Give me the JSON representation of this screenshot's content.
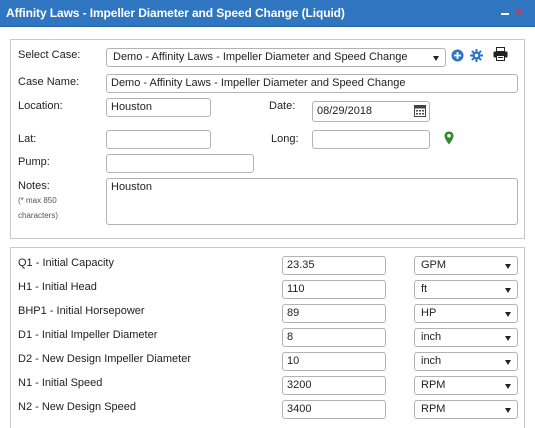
{
  "window": {
    "title": "Affinity Laws - Impeller Diameter and Speed Change (Liquid)",
    "minimize_icon": "minimize-icon",
    "close_icon": "close-icon",
    "close_glyph": "×",
    "accent_color": "#2f75c0"
  },
  "case_section": {
    "select_case": {
      "label": "Select Case:",
      "value": "Demo - Affinity Laws - Impeller Diameter and Speed Change"
    },
    "toolbar_icons": [
      "add-circle-icon",
      "gear-icon",
      "printer-icon"
    ],
    "case_name": {
      "label": "Case Name:",
      "value": "Demo - Affinity Laws - Impeller Diameter and Speed Change"
    },
    "location": {
      "label": "Location:",
      "value": "Houston"
    },
    "date": {
      "label": "Date:",
      "value": "08/29/2018",
      "icon": "calendar-icon"
    },
    "lat": {
      "label": "Lat:",
      "value": ""
    },
    "long": {
      "label": "Long:",
      "value": "",
      "icon": "map-pin-icon",
      "icon_color": "#2e8b2e"
    },
    "pump": {
      "label": "Pump:",
      "value": ""
    },
    "notes": {
      "label": "Notes:",
      "hint": "(* max 850 characters)",
      "value": "Houston"
    }
  },
  "parameters": [
    {
      "label": "Q1 - Initial Capacity",
      "value": "23.35",
      "unit": "GPM"
    },
    {
      "label": "H1 - Initial Head",
      "value": "110",
      "unit": "ft"
    },
    {
      "label": "BHP1 - Initial Horsepower",
      "value": "89",
      "unit": "HP"
    },
    {
      "label": "D1 - Initial Impeller Diameter",
      "value": "8",
      "unit": "inch"
    },
    {
      "label": "D2 - New Design Impeller Diameter",
      "value": "10",
      "unit": "inch"
    },
    {
      "label": "N1 - Initial Speed",
      "value": "3200",
      "unit": "RPM"
    },
    {
      "label": "N2 - New Design Speed",
      "value": "3400",
      "unit": "RPM"
    }
  ]
}
